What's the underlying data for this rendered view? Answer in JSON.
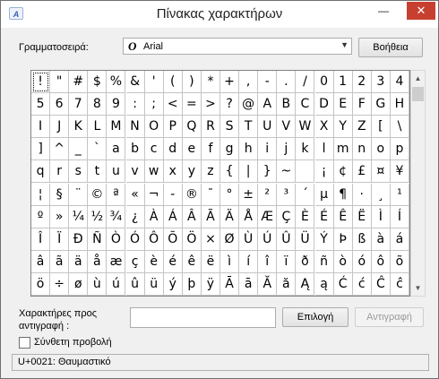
{
  "window": {
    "title": "Πίνακας χαρακτήρων",
    "minimize_glyph": "—",
    "maximize_glyph": "☐",
    "close_glyph": "✕",
    "app_icon_glyph": "A"
  },
  "font_row": {
    "label": "Γραμματοσειρά:",
    "font_icon": "O",
    "font_name": "Arial",
    "dropdown_glyph": "▼",
    "help_button": "Βοήθεια"
  },
  "characters": [
    [
      "!",
      "\"",
      "#",
      "$",
      "%",
      "&",
      "'",
      "(",
      ")",
      "*",
      "+",
      ",",
      "-",
      ".",
      "/",
      "0",
      "1",
      "2",
      "3",
      "4"
    ],
    [
      "5",
      "6",
      "7",
      "8",
      "9",
      ":",
      ";",
      "<",
      "=",
      ">",
      "?",
      "@",
      "A",
      "B",
      "C",
      "D",
      "E",
      "F",
      "G",
      "H"
    ],
    [
      "I",
      "J",
      "K",
      "L",
      "M",
      "N",
      "O",
      "P",
      "Q",
      "R",
      "S",
      "T",
      "U",
      "V",
      "W",
      "X",
      "Y",
      "Z",
      "[",
      "\\"
    ],
    [
      "]",
      "^",
      "_",
      "`",
      "a",
      "b",
      "c",
      "d",
      "e",
      "f",
      "g",
      "h",
      "i",
      "j",
      "k",
      "l",
      "m",
      "n",
      "o",
      "p"
    ],
    [
      "q",
      "r",
      "s",
      "t",
      "u",
      "v",
      "w",
      "x",
      "y",
      "z",
      "{",
      "|",
      "}",
      "~",
      " ",
      "¡",
      "¢",
      "£",
      "¤",
      "¥"
    ],
    [
      "¦",
      "§",
      "¨",
      "©",
      "ª",
      "«",
      "¬",
      "-",
      "®",
      "¯",
      "°",
      "±",
      "²",
      "³",
      "´",
      "µ",
      "¶",
      "·",
      "¸",
      "¹"
    ],
    [
      "º",
      "»",
      "¼",
      "½",
      "¾",
      "¿",
      "À",
      "Á",
      "Â",
      "Ã",
      "Ä",
      "Å",
      "Æ",
      "Ç",
      "È",
      "É",
      "Ê",
      "Ë",
      "Ì",
      "Í"
    ],
    [
      "Î",
      "Ï",
      "Ð",
      "Ñ",
      "Ò",
      "Ó",
      "Ô",
      "Õ",
      "Ö",
      "×",
      "Ø",
      "Ù",
      "Ú",
      "Û",
      "Ü",
      "Ý",
      "Þ",
      "ß",
      "à",
      "á"
    ],
    [
      "â",
      "ã",
      "ä",
      "å",
      "æ",
      "ç",
      "è",
      "é",
      "ê",
      "ë",
      "ì",
      "í",
      "î",
      "ï",
      "ð",
      "ñ",
      "ò",
      "ó",
      "ô",
      "õ"
    ],
    [
      "ö",
      "÷",
      "ø",
      "ù",
      "ú",
      "û",
      "ü",
      "ý",
      "þ",
      "ÿ",
      "Ā",
      "ā",
      "Ă",
      "ă",
      "Ą",
      "ą",
      "Ć",
      "ć",
      "Ĉ",
      "ĉ"
    ]
  ],
  "selected_character": "!",
  "scrollbar": {
    "up_glyph": "▲",
    "down_glyph": "▼"
  },
  "copy_row": {
    "label": "Χαρακτήρες προς αντιγραφή :",
    "value": "",
    "select_button": "Επιλογή",
    "copy_button": "Αντιγραφή"
  },
  "advanced_view": {
    "label": "Σύνθετη προβολή",
    "checked": false
  },
  "status": "U+0021: Θαυμαστικό"
}
